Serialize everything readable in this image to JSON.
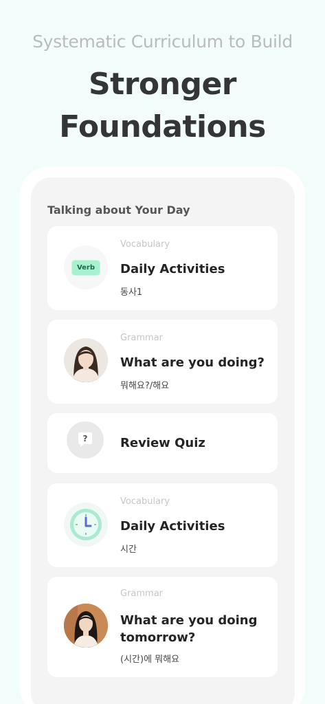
{
  "header": {
    "subtitle": "Systematic Curriculum to Build",
    "title": "Stronger Foundations"
  },
  "section": {
    "title": "Talking about Your Day"
  },
  "lessons": [
    {
      "category": "Vocabulary",
      "title": "Daily Activities",
      "subtitle": "동사1",
      "icon": "verb-badge",
      "badge_label": "Verb"
    },
    {
      "category": "Grammar",
      "title": "What are you doing?",
      "subtitle": "뭐해요?/해요",
      "icon": "tutor-avatar"
    },
    {
      "category": "",
      "title": "Review Quiz",
      "subtitle": "",
      "icon": "question-bubble-icon"
    },
    {
      "category": "Vocabulary",
      "title": "Daily Activities",
      "subtitle": "시간",
      "icon": "clock-icon"
    },
    {
      "category": "Grammar",
      "title": "What are you doing tomorrow?",
      "subtitle": "(시간)에 뭐해요",
      "icon": "tutor-avatar"
    }
  ],
  "colors": {
    "background": "#f2fdfb",
    "accent": "#a9f0cf"
  }
}
